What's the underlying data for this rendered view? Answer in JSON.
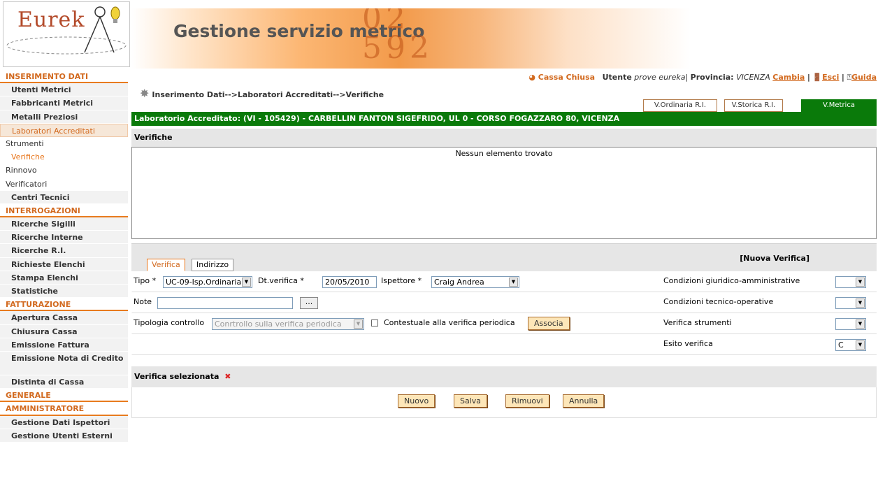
{
  "header": {
    "logo_text": "Eurek",
    "banner_title": "Gestione servizio metrico",
    "banner_digits": "0 2\n5 9 2"
  },
  "sidebar": {
    "items": [
      {
        "label": "INSERIMENTO DATI",
        "kind": "sec"
      },
      {
        "label": "Utenti Metrici",
        "kind": "item"
      },
      {
        "label": "Fabbricanti Metrici",
        "kind": "item"
      },
      {
        "label": "Metalli Preziosi",
        "kind": "item"
      },
      {
        "label": "Laboratori Accreditati",
        "kind": "active"
      },
      {
        "label": "Strumenti",
        "kind": "plain"
      },
      {
        "label": "Verifiche",
        "kind": "sub"
      },
      {
        "label": "Rinnovo",
        "kind": "plain"
      },
      {
        "label": "Verificatori",
        "kind": "plain"
      },
      {
        "label": "Centri Tecnici",
        "kind": "item"
      },
      {
        "label": "INTERROGAZIONI",
        "kind": "sec"
      },
      {
        "label": "Ricerche Sigilli",
        "kind": "item"
      },
      {
        "label": "Ricerche Interne",
        "kind": "item"
      },
      {
        "label": "Ricerche R.I.",
        "kind": "item"
      },
      {
        "label": "Richieste Elenchi",
        "kind": "item"
      },
      {
        "label": "Stampa Elenchi",
        "kind": "item"
      },
      {
        "label": "Statistiche",
        "kind": "item"
      },
      {
        "label": "FATTURAZIONE",
        "kind": "sec"
      },
      {
        "label": "Apertura Cassa",
        "kind": "item"
      },
      {
        "label": "Chiusura Cassa",
        "kind": "item"
      },
      {
        "label": "Emissione Fattura",
        "kind": "item"
      },
      {
        "label": "Emissione Nota di Credito",
        "kind": "two"
      },
      {
        "label": "Distinta di Cassa",
        "kind": "item"
      },
      {
        "label": "GENERALE",
        "kind": "sec"
      },
      {
        "label": "AMMINISTRATORE",
        "kind": "sec"
      },
      {
        "label": "Gestione Dati Ispettori",
        "kind": "item"
      },
      {
        "label": "Gestione Utenti Esterni",
        "kind": "item"
      }
    ]
  },
  "userbar": {
    "cassa": "Cassa Chiusa",
    "utente_label": "Utente",
    "utente_value": "prove eureka",
    "provincia_label": "Provincia:",
    "provincia_value": "VICENZA",
    "cambia": "Cambia",
    "esci": "Esci",
    "guida": "Guida"
  },
  "breadcrumb": "Inserimento Dati-->Laboratori Accreditati-->Verifiche",
  "view_tabs": [
    "V.Ordinaria R.I.",
    "V.Storica R.I.",
    "V.Metrica"
  ],
  "lab_bar": "Laboratorio Accreditato: (VI - 105429) - CARBELLIN FANTON SIGEFRIDO, UL 0 - CORSO FOGAZZARO 80, VICENZA",
  "verifiche": {
    "header": "Verifiche",
    "empty": "Nessun elemento trovato"
  },
  "form": {
    "tabs": [
      "Verifica",
      "Indirizzo"
    ],
    "nuova": "[Nuova Verifica]",
    "tipo_label": "Tipo *",
    "tipo_value": "UC-09-Isp.Ordinaria",
    "dt_label": "Dt.verifica *",
    "dt_value": "20/05/2010",
    "ispettore_label": "Ispettore *",
    "ispettore_value": "Craig Andrea",
    "note_label": "Note",
    "note_value": "",
    "dots": "...",
    "tipologia_label": "Tipologia controllo",
    "tipologia_value": "Conrtrollo sulla verifica periodica",
    "contestuale_label": "Contestuale alla verifica periodica",
    "associa": "Associa",
    "cond_giur_label": "Condizioni giuridico-amministrative",
    "cond_giur_value": "",
    "cond_tec_label": "Condizioni tecnico-operative",
    "cond_tec_value": "",
    "ver_strum_label": "Verifica strumenti",
    "ver_strum_value": "",
    "esito_label": "Esito verifica",
    "esito_value": "C"
  },
  "selected": {
    "header": "Verifica selezionata"
  },
  "buttons": {
    "nuovo": "Nuovo",
    "salva": "Salva",
    "rimuovi": "Rimuovi",
    "annulla": "Annulla"
  }
}
